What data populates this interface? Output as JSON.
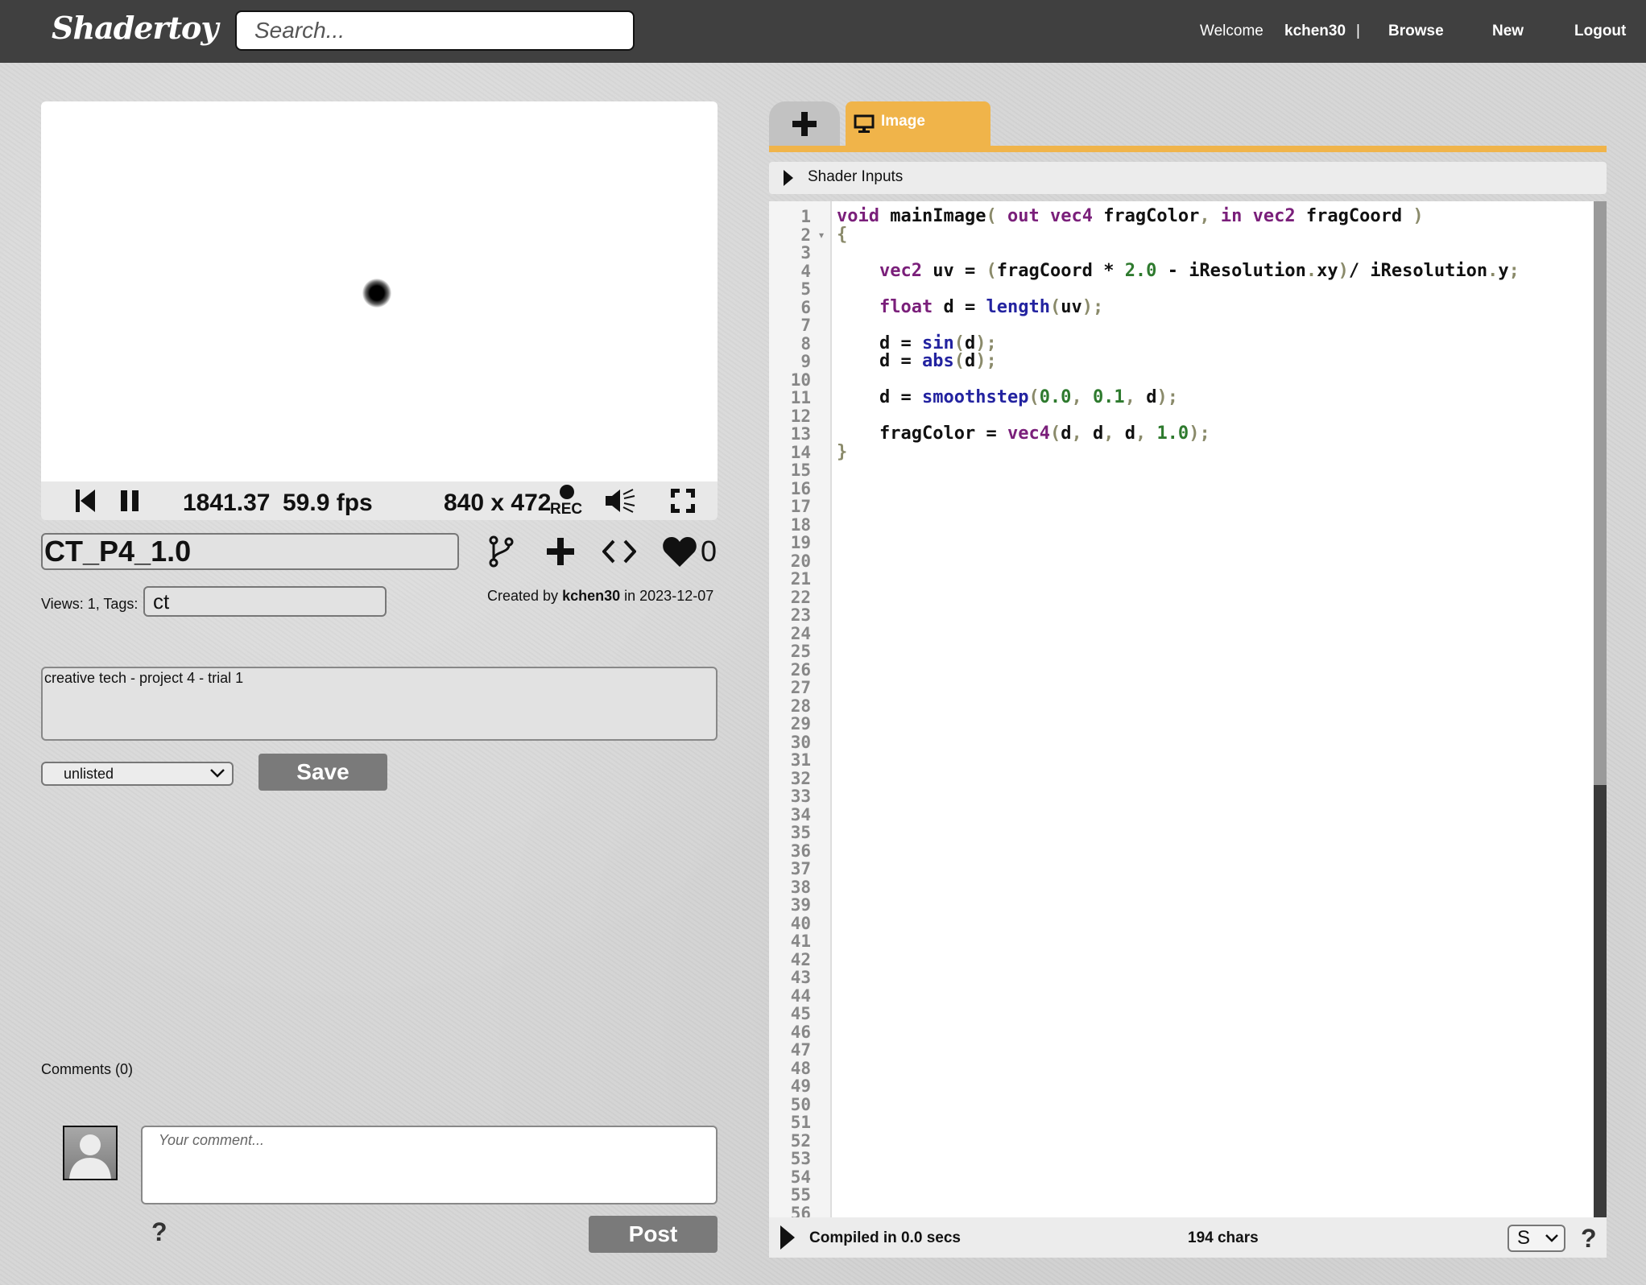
{
  "header": {
    "logo": "Shadertoy",
    "search_placeholder": "Search...",
    "welcome": "Welcome",
    "username": "kchen30",
    "separator": "|",
    "browse": "Browse",
    "new": "New",
    "logout": "Logout"
  },
  "player": {
    "time": "1841.37",
    "fps": "59.9 fps",
    "resolution": "840 x 472",
    "rec_label": "REC"
  },
  "shader": {
    "title": "CT_P4_1.0",
    "likes": "0",
    "views_tags_label": "Views: 1, Tags:",
    "tags": "ct",
    "created_prefix": "Created by",
    "author": "kchen30",
    "created_suffix": "in 2023-12-07",
    "description": "creative tech - project 4 - trial 1",
    "visibility": "unlisted",
    "save_label": "Save"
  },
  "comments": {
    "heading": "Comments (0)",
    "placeholder": "Your comment...",
    "help": "?",
    "post_label": "Post"
  },
  "editor": {
    "tab_image": "Image",
    "shader_inputs": "Shader Inputs",
    "line_count": 56,
    "compiled": "Compiled in 0.0 secs",
    "chars": "194 chars",
    "font_size_option": "S",
    "help": "?",
    "code_lines": [
      "void mainImage( out vec4 fragColor, in vec2 fragCoord )",
      "{",
      "",
      "    vec2 uv = (fragCoord * 2.0 - iResolution.xy)/ iResolution.y;",
      "",
      "    float d = length(uv);",
      "",
      "    d = sin(d);",
      "    d = abs(d);",
      "",
      "    d = smoothstep(0.0, 0.1, d);",
      "",
      "    fragColor = vec4(d, d, d, 1.0);",
      "}"
    ]
  },
  "colors": {
    "topbar": "#404040",
    "tab_accent": "#f0b44a",
    "button": "#7a7a7a"
  }
}
